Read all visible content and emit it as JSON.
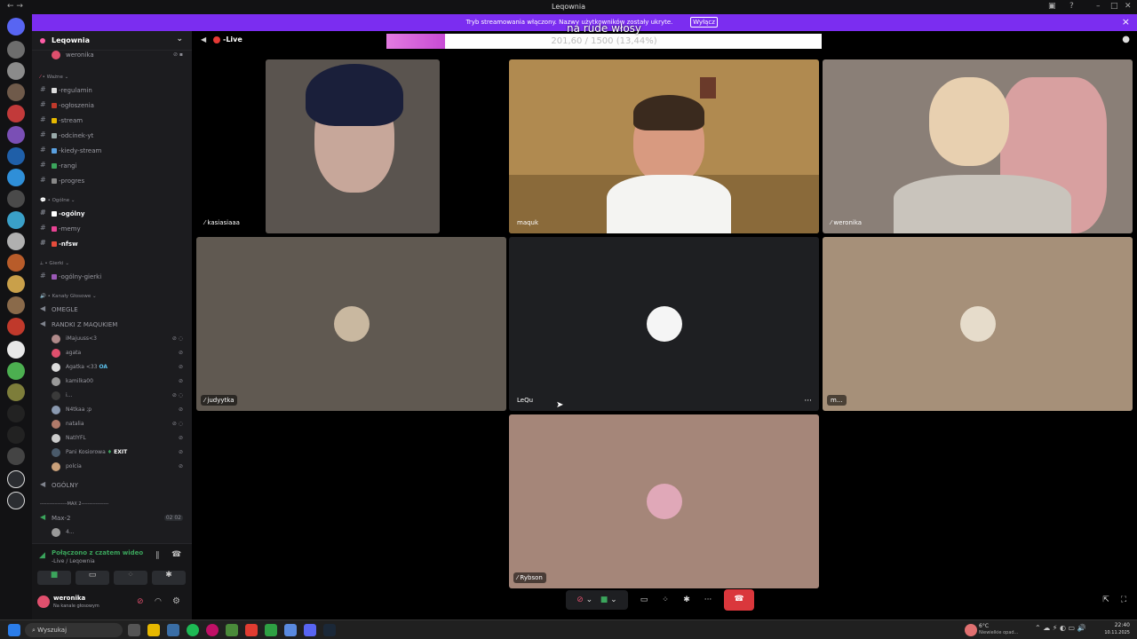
{
  "window": {
    "title": "Leqownia"
  },
  "banner": {
    "message": "Tryb streamowania włączony. Nazwy użytkowników zostały ukryte.",
    "disable_label": "Wyłącz",
    "close_label": "×"
  },
  "server": {
    "name": "Leqownia",
    "top_user": "weronika",
    "categories": [
      {
        "name": "Ważne"
      },
      {
        "name": "Ogólne"
      },
      {
        "name": "Gierki"
      },
      {
        "name": "Kanały Głosowe"
      }
    ],
    "channels_wazne": [
      "-regulamin",
      "-ogłoszenia",
      "-stream",
      "-odcinek-yt",
      "-kiedy-stream",
      "-rangi",
      "-progres"
    ],
    "channels_ogolne": [
      "-ogólny",
      "-memy",
      "-nfsw"
    ],
    "channels_gierki": [
      "-ogólny-gierki"
    ],
    "voice_omegle": "OMEGLE",
    "voice_randki": "RANDKI Z MAQUKIEM",
    "voice_users": [
      "iMajuuss<3",
      "agata",
      "Agatka <33",
      "kamilka00",
      "i...",
      "N4tkaa ;p",
      "natalia",
      "NatIYFL",
      "Pani Kosiorowa",
      "polcia"
    ],
    "badge_oa": "OA",
    "badge_exit": "EXIT",
    "voice_ogolny": "OGÓLNY",
    "voice_max_divider": "-----------------MAX 2-----------------",
    "voice_max2": "Max-2",
    "max2_counts": "02 02",
    "max2_user": "4..."
  },
  "connection": {
    "status": "Połączono z czatem wideo",
    "location": "-Live / Leqownia"
  },
  "user": {
    "name": "weronika",
    "status": "Na kanale głosowym"
  },
  "channel": {
    "name": "-Live"
  },
  "goal": {
    "title": "na rude włosy",
    "progress_text": "201,60 / 1500 (13,44%)",
    "fraction": 0.1344
  },
  "tiles": [
    {
      "name": "kasiasiaaa",
      "bg": "#5a544f"
    },
    {
      "name": "maquk",
      "bg": "#b08a50"
    },
    {
      "name": "weronika",
      "bg": "#8a7f77"
    },
    {
      "name": "judyytka",
      "bg": "#605951"
    },
    {
      "name": "LeQu",
      "bg": "#1e1f22"
    },
    {
      "name": "m...",
      "bg": "#a69079"
    },
    {
      "name": "Rybson",
      "bg": "#a58679"
    }
  ],
  "call_more": "···",
  "taskbar": {
    "search_placeholder": "Wyszukaj",
    "weather_temp": "6°C",
    "weather_desc": "Niewielkie opad...",
    "time": "22:40",
    "date": "10.11.2025"
  }
}
